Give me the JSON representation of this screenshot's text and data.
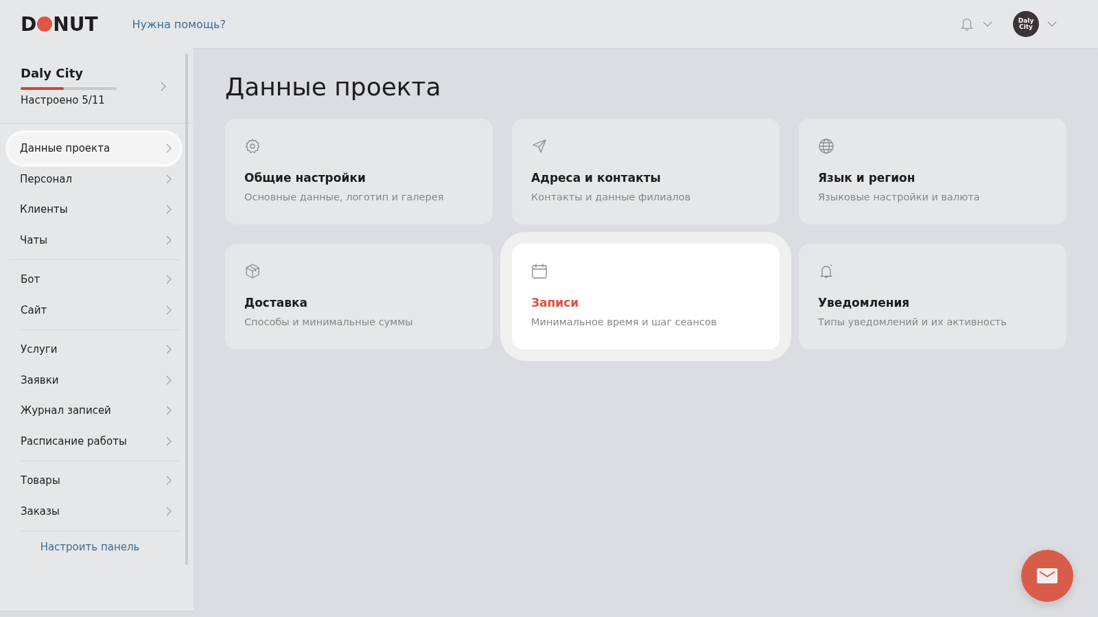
{
  "header": {
    "logo": {
      "before": "D",
      "after": "NUT"
    },
    "help_link": "Нужна помощь?",
    "avatar": "Daly City"
  },
  "sidebar": {
    "project": {
      "name": "Daly City",
      "level": 0.45,
      "progress_text": "Настроено 5/11"
    },
    "groups": [
      [
        {
          "label": "Данные проекта",
          "selected": true
        },
        {
          "label": "Персонал",
          "selected": false
        },
        {
          "label": "Клиенты",
          "selected": false
        },
        {
          "label": "Чаты",
          "selected": false
        }
      ],
      [
        {
          "label": "Бот",
          "selected": false
        },
        {
          "label": "Сайт",
          "selected": false
        }
      ],
      [
        {
          "label": "Услуги",
          "selected": false
        },
        {
          "label": "Заявки",
          "selected": false
        },
        {
          "label": "Журнал записей",
          "selected": false
        },
        {
          "label": "Расписание работы",
          "selected": false
        }
      ],
      [
        {
          "label": "Товары",
          "selected": false
        },
        {
          "label": "Заказы",
          "selected": false
        }
      ]
    ],
    "customize_link": "Настроить панель"
  },
  "page_title": "Данные проекта",
  "cards": [
    {
      "kind": "gear",
      "title": "Общие настройки",
      "subtitle": "Основные данные, логотип и галерея",
      "selected": false
    },
    {
      "kind": "send",
      "title": "Адреса и контакты",
      "subtitle": "Контакты и данные филиалов",
      "selected": false
    },
    {
      "kind": "globe",
      "title": "Язык и регион",
      "subtitle": "Языковые настройки и валюта",
      "selected": false
    },
    {
      "kind": "box",
      "title": "Доставка",
      "subtitle": "Способы и минимальные суммы",
      "selected": false
    },
    {
      "kind": "calendar",
      "title": "Записи",
      "subtitle": "Минимальное время и шаг сеансов",
      "selected": true
    },
    {
      "kind": "bell",
      "title": "Уведомления",
      "subtitle": "Типы уведомлений и их активность",
      "selected": false
    }
  ]
}
